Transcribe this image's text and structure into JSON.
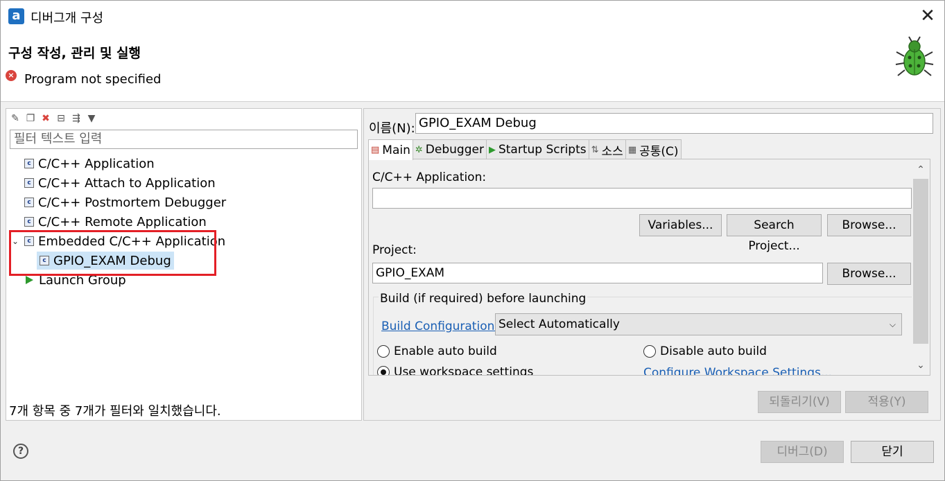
{
  "window": {
    "title": "디버그개 구성",
    "app_icon_letter": "a",
    "close_glyph": "✕"
  },
  "header": {
    "title": "구성 작성, 관리 및 실행",
    "error_message": "Program not specified",
    "error_glyph": "×"
  },
  "left": {
    "filter_placeholder": "필터 텍스트 입력",
    "tree": [
      {
        "label": "C/C++ Application"
      },
      {
        "label": "C/C++ Attach to Application"
      },
      {
        "label": "C/C++ Postmortem Debugger"
      },
      {
        "label": "C/C++ Remote Application"
      },
      {
        "label": "Embedded C/C++ Application"
      },
      {
        "label": "GPIO_EXAM Debug"
      },
      {
        "label": "Launch Group"
      }
    ],
    "status": "7개 항목 중 7개가 필터와 일치했습니다."
  },
  "right": {
    "name_label": "이름(N):",
    "name_value": "GPIO_EXAM Debug",
    "tabs": [
      {
        "label": "Main",
        "icon": "main-tab-icon",
        "glyph": "▤"
      },
      {
        "label": "Debugger",
        "icon": "debugger-tab-icon",
        "glyph": "✲"
      },
      {
        "label": "Startup Scripts",
        "icon": "startup-tab-icon",
        "glyph": "▶"
      },
      {
        "label": "소스",
        "icon": "source-tab-icon",
        "glyph": "⇅"
      },
      {
        "label": "공통(C)",
        "icon": "common-tab-icon",
        "glyph": "▦"
      }
    ],
    "main": {
      "app_label": "C/C++ Application:",
      "app_value": "",
      "variables_button": "Variables...",
      "search_project_button": "Search Project...",
      "browse_button": "Browse...",
      "project_label": "Project:",
      "project_value": "GPIO_EXAM",
      "project_browse_button": "Browse...",
      "build_group_title": "Build (if required) before launching",
      "build_config_link": "Build Configuration:",
      "build_config_value": "Select Automatically",
      "enable_auto_build": "Enable auto build",
      "disable_auto_build": "Disable auto build",
      "use_workspace_settings": "Use workspace settings",
      "configure_workspace_link": "Configure Workspace Settings..."
    },
    "revert_button": "되돌리기(V)",
    "apply_button": "적용(Y)"
  },
  "footer": {
    "debug_button": "디버그(D)",
    "close_button": "닫기",
    "help_glyph": "?"
  },
  "colors": {
    "highlight_box": "#e31f26",
    "selection": "#cce4f7",
    "link": "#1a5fb4",
    "error": "#d9443d"
  }
}
